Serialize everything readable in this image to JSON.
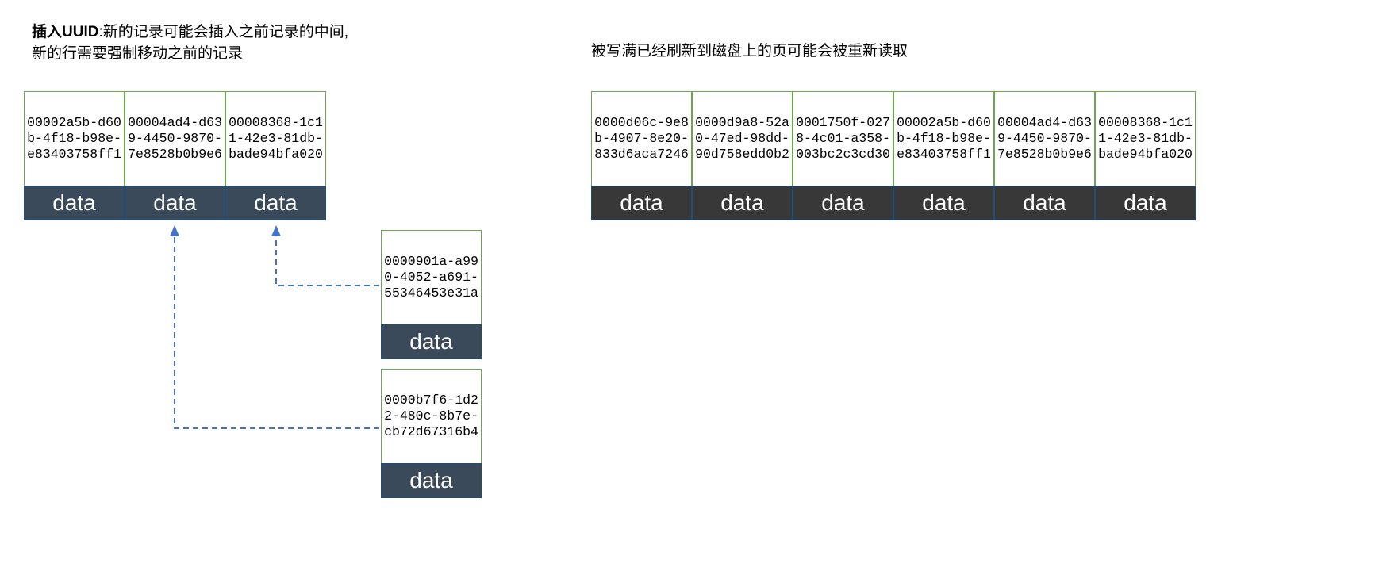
{
  "left_caption_bold": "插入UUID",
  "left_caption_rest": ":新的记录可能会插入之前记录的中间,\n新的行需要强制移动之前的记录",
  "right_caption": "被写满已经刷新到磁盘上的页可能会被重新读取",
  "data_label": "data",
  "left_row": [
    "00002a5b-d60b-4f18-b98e-e83403758ff1",
    "00004ad4-d639-4450-9870-7e8528b0b9e6",
    "00008368-1c11-42e3-81db-bade94bfa020"
  ],
  "right_row": [
    "0000d06c-9e8b-4907-8e20-833d6aca7246",
    "0000d9a8-52a0-47ed-98dd-90d758edd0b2",
    "0001750f-0278-4c01-a358-003bc2c3cd30",
    "00002a5b-d60b-4f18-b98e-e83403758ff1",
    "00004ad4-d639-4450-9870-7e8528b0b9e6",
    "00008368-1c11-42e3-81db-bade94bfa020"
  ],
  "insert1": "0000901a-a990-4052-a691-55346453e31a",
  "insert2": "0000b7f6-1d22-480c-8b7e-cb72d67316b4"
}
